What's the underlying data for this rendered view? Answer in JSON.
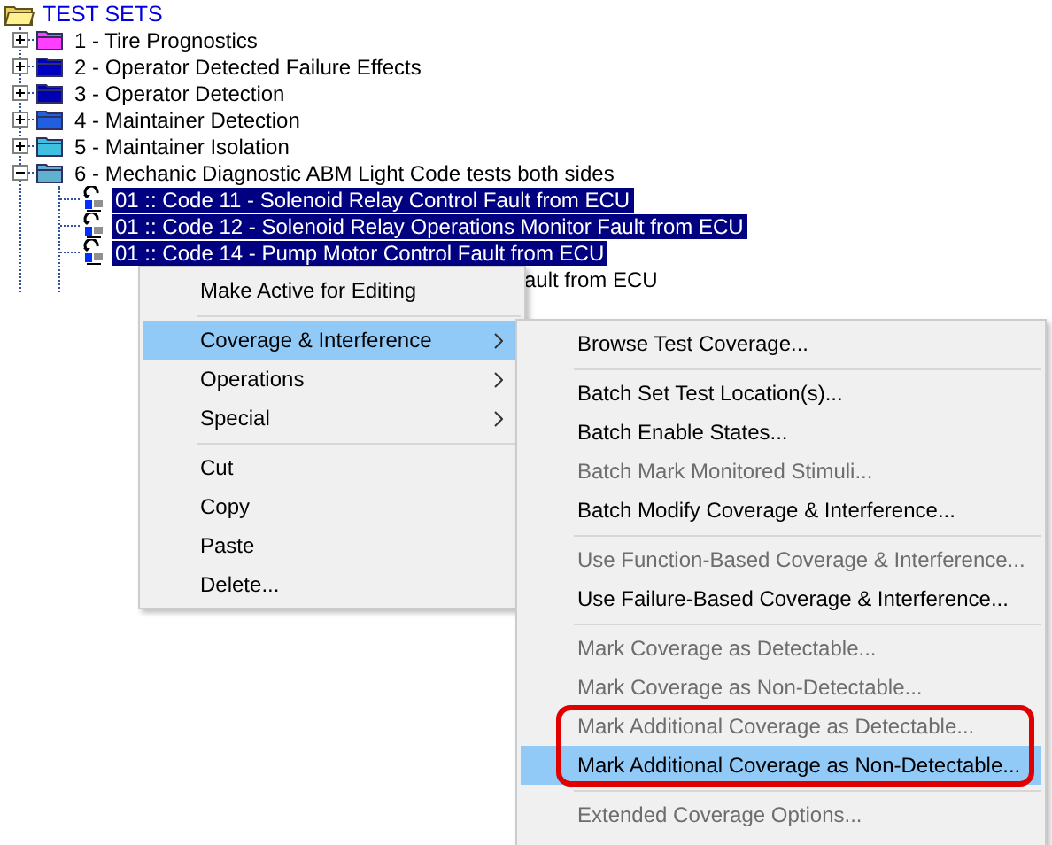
{
  "tree": {
    "label": "TEST SETS",
    "expanded": true,
    "children": [
      {
        "label": "1 - Tire Prognostics",
        "color": "#ff40ff",
        "expanded": false
      },
      {
        "label": "2 - Operator Detected Failure Effects",
        "color": "#0000c0",
        "expanded": false
      },
      {
        "label": "3 - Operator Detection",
        "color": "#0000b0",
        "expanded": false
      },
      {
        "label": "4 - Maintainer Detection",
        "color": "#2060e0",
        "expanded": false
      },
      {
        "label": "5 - Maintainer Isolation",
        "color": "#40c0e0",
        "expanded": false
      },
      {
        "label": "6 - Mechanic Diagnostic ABM Light Code tests both sides",
        "color": "#60b0d0",
        "expanded": true,
        "children": [
          {
            "label": "01 :: Code 11 - Solenoid Relay Control Fault from ECU",
            "selected": true
          },
          {
            "label": "01 :: Code 12 - Solenoid Relay Operations Monitor Fault from ECU",
            "selected": true
          },
          {
            "label": "01 :: Code 14 - Pump Motor Control Fault from ECU",
            "selected": true
          },
          {
            "label": "ault from ECU",
            "kind": "fragment"
          }
        ]
      }
    ]
  },
  "context_menu": {
    "items": [
      {
        "kind": "item",
        "label": "Make Active for Editing",
        "selected": false,
        "disabled": false,
        "submenu": false
      },
      {
        "kind": "separator"
      },
      {
        "kind": "item",
        "label": "Coverage & Interference",
        "selected": true,
        "disabled": false,
        "submenu": true
      },
      {
        "kind": "item",
        "label": "Operations",
        "selected": false,
        "disabled": false,
        "submenu": true
      },
      {
        "kind": "item",
        "label": "Special",
        "selected": false,
        "disabled": false,
        "submenu": true
      },
      {
        "kind": "separator"
      },
      {
        "kind": "item",
        "label": "Cut",
        "selected": false,
        "disabled": false,
        "submenu": false
      },
      {
        "kind": "item",
        "label": "Copy",
        "selected": false,
        "disabled": false,
        "submenu": false
      },
      {
        "kind": "item",
        "label": "Paste",
        "selected": false,
        "disabled": false,
        "submenu": false
      },
      {
        "kind": "item",
        "label": "Delete...",
        "selected": false,
        "disabled": false,
        "submenu": false
      }
    ]
  },
  "submenu": {
    "items": [
      {
        "kind": "item",
        "label": "Browse Test Coverage...",
        "selected": false,
        "disabled": false,
        "outlined": false
      },
      {
        "kind": "separator"
      },
      {
        "kind": "item",
        "label": "Batch Set Test Location(s)...",
        "selected": false,
        "disabled": false,
        "outlined": false
      },
      {
        "kind": "item",
        "label": "Batch Enable States...",
        "selected": false,
        "disabled": false,
        "outlined": false
      },
      {
        "kind": "item",
        "label": "Batch Mark Monitored Stimuli...",
        "selected": false,
        "disabled": true,
        "outlined": false
      },
      {
        "kind": "item",
        "label": "Batch Modify Coverage & Interference...",
        "selected": false,
        "disabled": false,
        "outlined": false
      },
      {
        "kind": "separator"
      },
      {
        "kind": "item",
        "label": "Use Function-Based Coverage & Interference...",
        "selected": false,
        "disabled": true,
        "outlined": false
      },
      {
        "kind": "item",
        "label": "Use Failure-Based Coverage & Interference...",
        "selected": false,
        "disabled": false,
        "outlined": false
      },
      {
        "kind": "separator"
      },
      {
        "kind": "item",
        "label": "Mark Coverage as Detectable...",
        "selected": false,
        "disabled": true,
        "outlined": false
      },
      {
        "kind": "item",
        "label": "Mark Coverage as Non-Detectable...",
        "selected": false,
        "disabled": true,
        "outlined": false
      },
      {
        "kind": "item",
        "label": "Mark Additional Coverage as Detectable...",
        "selected": false,
        "disabled": true,
        "outlined": true
      },
      {
        "kind": "item",
        "label": "Mark Additional Coverage as Non-Detectable...",
        "selected": true,
        "disabled": false,
        "outlined": true
      },
      {
        "kind": "separator"
      },
      {
        "kind": "item",
        "label": "Extended Coverage Options...",
        "selected": false,
        "disabled": true,
        "outlined": false
      }
    ]
  }
}
